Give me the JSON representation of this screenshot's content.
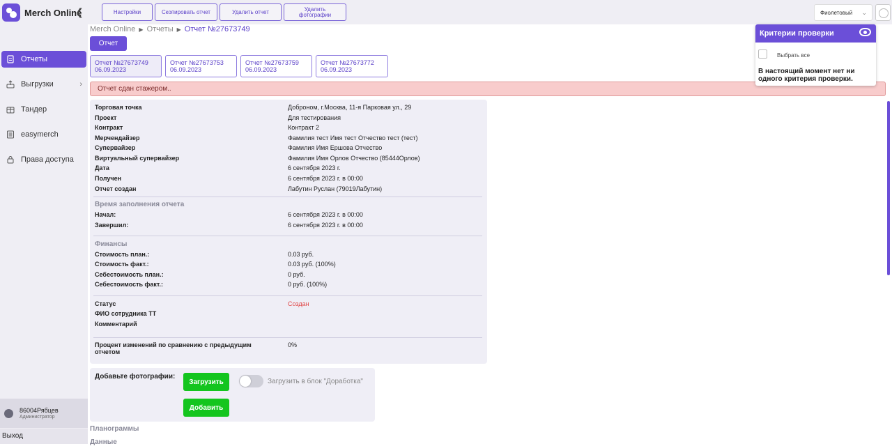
{
  "app": {
    "name": "Merch Online"
  },
  "sidebar": {
    "items": [
      {
        "label": "Отчеты",
        "icon": "report-icon",
        "active": true
      },
      {
        "label": "Выгрузки",
        "icon": "export-icon",
        "has_submenu": true
      },
      {
        "label": "Тандер",
        "icon": "store-icon"
      },
      {
        "label": "easymerch",
        "icon": "list-icon"
      },
      {
        "label": "Права доступа",
        "icon": "lock-icon"
      }
    ],
    "user": {
      "name": "86004Рябцев",
      "role": "Администратор"
    },
    "logout_label": "Выход"
  },
  "toolbar": {
    "settings_label": "Настройки",
    "copy_label": "Скопировать отчет",
    "delete_label": "Удалить отчет",
    "delete_photos_label": "Удалить фотографии",
    "theme_value": "Фиолетовый"
  },
  "breadcrumb": [
    "Merch Online",
    "Отчеты",
    "Отчет №27673749"
  ],
  "report_tab_label": "Отчет",
  "reports": [
    {
      "title": "Отчет №27673749",
      "date": "06.09.2023"
    },
    {
      "title": "Отчет №27673753",
      "date": "06.09.2023"
    },
    {
      "title": "Отчет №27673759",
      "date": "06.09.2023"
    },
    {
      "title": "Отчет №27673772",
      "date": "06.09.2023"
    }
  ],
  "alert_text": "Отчет сдан стажером..",
  "info": {
    "fields": [
      {
        "label": "Торговая точка",
        "value": "Доброном, г.Москва, 11-я Парковая ул., 29"
      },
      {
        "label": "Проект",
        "value": "Для тестирования"
      },
      {
        "label": "Контракт",
        "value": "Контракт 2"
      },
      {
        "label": "Мерчендайзер",
        "value": "Фамилия тест Имя тест Отчество тест (тест)"
      },
      {
        "label": "Супервайзер",
        "value": "Фамилия Имя Ершова Отчество"
      },
      {
        "label": "Виртуальный супервайзер",
        "value": "Фамилия Имя Орлов Отчество (85444Орлов)"
      },
      {
        "label": "Дата",
        "value": "6 сентября 2023 г."
      },
      {
        "label": "Получен",
        "value": "6 сентября 2023 г. в 00:00"
      },
      {
        "label": "Отчет создан",
        "value": "Лабутин Руслан (79019Лабутин)"
      }
    ],
    "time_section": "Время заполнения отчета",
    "time_fields": [
      {
        "label": "Начал:",
        "value": "6 сентября 2023 г. в 00:00"
      },
      {
        "label": "Завершил:",
        "value": "6 сентября 2023 г. в 00:00"
      }
    ],
    "finance_section": "Финансы",
    "finance_fields": [
      {
        "label": "Стоимость план.:",
        "value": "0.03 руб."
      },
      {
        "label": "Стоимость факт.:",
        "value": "0.03 руб. (100%)"
      },
      {
        "label": "Себестоимость план.:",
        "value": "0 руб."
      },
      {
        "label": "Себестоимость факт.:",
        "value": "0 руб. (100%)"
      }
    ],
    "status_fields": [
      {
        "label": "Статус",
        "value": "Создан"
      },
      {
        "label": "ФИО сотрудника ТТ",
        "value": ""
      },
      {
        "label": "Комментарий",
        "value": ""
      }
    ],
    "change_label": "Процент изменений по сравнению с предыдущим отчетом",
    "change_value": "0%"
  },
  "upload": {
    "label": "Добавьте фотографии:",
    "upload_button": "Загрузить",
    "add_button": "Добавить",
    "toggle_label": "Загрузить в блок \"Доработка\""
  },
  "subsections": [
    "Планограммы",
    "Данные"
  ],
  "criteria": {
    "title": "Критерии проверки",
    "select_all": "Выбрать все",
    "empty_note": "В настоящий момент нет ни одного критерия проверки."
  }
}
